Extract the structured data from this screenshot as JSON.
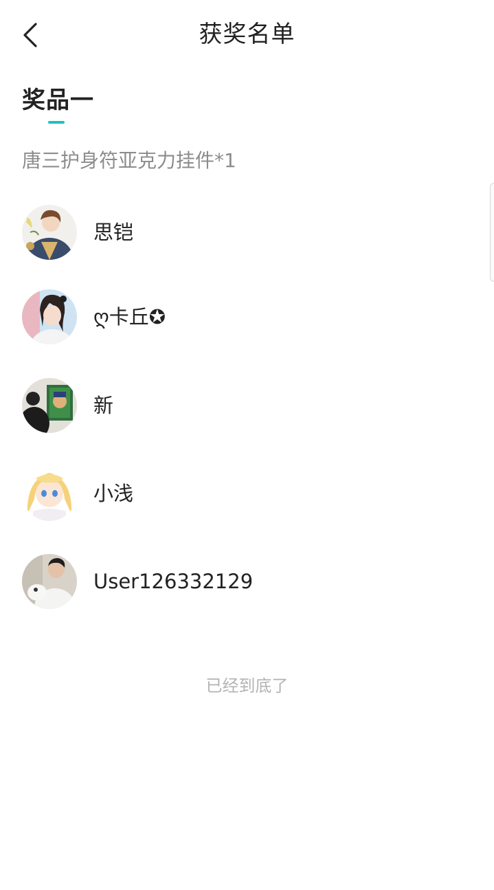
{
  "header": {
    "back_icon": "chevron-left-icon",
    "title": "获奖名单"
  },
  "tab": {
    "label": "奖品一",
    "accent_color": "#1ec1c3"
  },
  "prize": {
    "description": "唐三护身符亚克力挂件*1"
  },
  "winners": [
    {
      "name": "思铠"
    },
    {
      "name": "ღ卡丘✪"
    },
    {
      "name": "新"
    },
    {
      "name": "小浅"
    },
    {
      "name": "User126332129"
    }
  ],
  "footer": {
    "end_text": "已经到底了"
  }
}
